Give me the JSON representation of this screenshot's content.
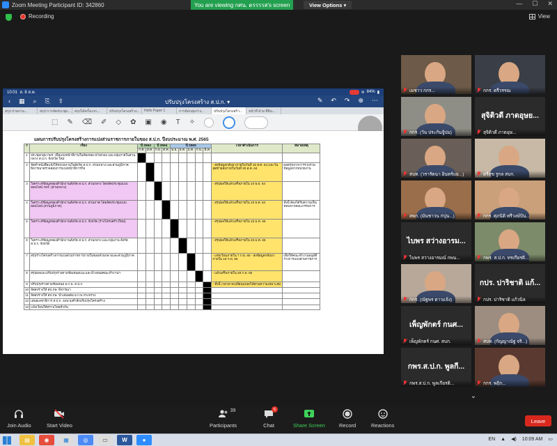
{
  "window": {
    "title": "Zoom Meeting Participant ID: 342860",
    "viewing_banner": "You are viewing กศน. ตรรรรส's screen",
    "view_options": "View Options"
  },
  "status": {
    "recording": "Recording",
    "view": "View"
  },
  "shared_screen": {
    "time": "10:01",
    "date": "ส. 8 ส.ค.",
    "battery": "84%",
    "document_title": "ปรับปรุงโครงสร้าง ส.ป.ก.",
    "tabs": [
      "สรุป ถ่ายงาน...",
      "สรุป การจัดประชุม...",
      "สรุปได้ครั้งแรก...",
      "ปรับปรุงโครงสร้าง...",
      "Hello Paper 1",
      "การจัดกลุ่มร่าง...",
      "ปรับปรุงโครงสร้า...",
      "หน้าที่ ฝ่าย ที่ดิน..."
    ],
    "sheet_title": "แผนการปรับปรุงโครงสร้างการแบ่งส่วนราชการภายในของ ส.ป.ก. ปีงบประมาณ พ.ศ. 2565",
    "table": {
      "header_item": "เรื่อง",
      "header_y64": "ปี 2564",
      "header_y64b": "ปี 2564",
      "header_y65": "ปี 2565",
      "months": [
        "ก.ค.",
        "ส.ค.",
        "ก.ย.",
        "ต.ค.",
        "พ.ย.",
        "ธ.ค.",
        "ม.ค.",
        "ก.พ.",
        "มี.ค."
      ],
      "header_date": "เวลาดำเนินการ",
      "header_note": "หมายเหตุ",
      "rows": [
        {
          "num": "1",
          "activity": "ประชุมกลุ่ม กพร. เพื่อแบ่งหน้าที่งานในห้องของ ฝ่าย/กอง และกลุ่มภายในส่วนกลาง ส.ป.ก. จังหวัด ใหม่",
          "bar": 0,
          "date": "",
          "note": ""
        },
        {
          "num": "2",
          "activity": "จัดทำหนังสือแจ้งให้หน่วยงานในสังกัด ส.ป.ก. ส่วนกลาง และส่วนภูมิภาค พิจารณาตรวจสอบการแบ่งหน้าที่ภารกิจ",
          "bar": 1,
          "date": "- ส่งข้อมูลกลับมาภายในวันที่ 15 ส.ค. 64 และวันสุดท้ายส่งภายในวันที่ 30 ส.ค. 64",
          "note": "ผลสรุปจากการรวบรวมข้อมูลจากหน่วยงาน"
        },
        {
          "num": "3",
          "activity": "วิเคราะห์ข้อมูลของสำนักงานสังกัด ส.ป.ก. ส่วนกลาง โดยจัดประชุมแบบออนไลน์ กพร. (ส่วนกลาง)",
          "bar": 2,
          "date": "- สรุปผลให้แล้วเสร็จภายใน 10 พ.ย. 64",
          "note": ""
        },
        {
          "num": "4",
          "activity": "วิเคราะห์ข้อมูลของสำนักงานสังกัด ส.ป.ก. ส่วนภาค โดยจัดประชุมแบบออนไลน์ (ส่วนภูมิภาค)",
          "bar": 3,
          "date": "- สรุปผลให้แล้วเสร็จภายใน 16 ธ.ค. 64",
          "note": "ทั้งนี้ ต้องได้รับความเห็นชอบจากคณะกรรมการ"
        },
        {
          "num": "5",
          "activity": "วิเคราะห์ข้อมูลของสำนักงานสังกัด ส.ป.ก. จังหวัด (ร่างโครงสร้างใหม่)",
          "bar": 4,
          "date": "- สรุปผลให้แล้วเสร็จภายใน 15 ม.ค. 65",
          "note": ""
        },
        {
          "num": "6",
          "activity": "วิเคราะห์ข้อมูลของสำนักงานสังกัด ส.ป.ก. ส่วนกลาง และกลุ่มงาน สังกัด ส.ป.ก. จังหวัด",
          "bar": 5,
          "date": "- สรุปผลให้แล้วเสร็จภายใน 25 ม.ค. 65",
          "note": ""
        },
        {
          "num": "7",
          "activity": "สรุปร่างโครงสร้างการแบ่งส่วนราชการภายในของส่วนกลางและส่วนภูมิภาค",
          "bar": 6,
          "date": "- แจ้งเวียนภายใน 7 ก.พ. 65 - ส่งข้อมูลกลับมาภายใน 18 ก.พ. 65",
          "note": "เพื่อให้คณะทำงานอนุมัติร่างการแบ่งส่วนราชการ"
        },
        {
          "num": "8",
          "activity": "สรุปผลและปรับปรุงร่างตามข้อเสนอแนะและนำเสนอคณะทำงานฯ",
          "bar": 7,
          "date": "- แล้วเสร็จภายใน 28 ก.พ. 65",
          "note": ""
        },
        {
          "num": "9",
          "activity": "ปรับปรุงร่างตามข้อเสนอ อ.ก.พ. ส.ป.ก.",
          "bar": 8,
          "date": "- ทั้งนี้ เวลาอาจเปลี่ยนแปลงได้ตามความเหมาะสม",
          "note": ""
        },
        {
          "num": "10",
          "activity": "จัดส่งร่างให้ สป.กษ. พิจารณา",
          "bar": 8,
          "date": "",
          "note": ""
        },
        {
          "num": "11",
          "activity": "จัดส่งร่างให้ สป.กษ. นำเสนอต่อ อ.ก.พ.กระทรวง",
          "bar": 8,
          "date": "",
          "note": ""
        },
        {
          "num": "12",
          "activity": "เสนอเลขาธิการ ส.ป.ก. ลงนามคำสั่งปรับปรุงโครงสร้าง",
          "bar": 8,
          "date": "",
          "note": ""
        },
        {
          "num": "13",
          "activity": "แจ้งเวียนให้ทราบโดยทั่วกัน",
          "bar": 8,
          "date": "",
          "note": ""
        }
      ]
    }
  },
  "gallery": {
    "tiles": [
      {
        "name": "เมชาว กกร...",
        "bg": "#6d5a48",
        "big": ""
      },
      {
        "name": "กกร. ตรีวรรณ",
        "bg": "#3a3f47",
        "big": ""
      },
      {
        "name": "กกร. (วัน ประกันจู้ปม)",
        "bg": "#8e8e86",
        "big": "",
        "active": true
      },
      {
        "name": "สุจิติวดี ภาดอุษ...",
        "bg": "#2b2b2b",
        "big": "สุจิติวดี ภาดอุษย..."
      },
      {
        "name": "สบท. (วรารัตนา อินทร์แย...)",
        "bg": "#6a5f58",
        "big": ""
      },
      {
        "name": "ตรีสุข รูกล สบก.",
        "bg": "#c7b9a6",
        "big": ""
      },
      {
        "name": "สพก. (มันชาวน ก่ปุน...)",
        "bg": "#9a6e4a",
        "big": ""
      },
      {
        "name": "กกร. ศุภนิติ ทรีวงษ์ปัน...",
        "bg": "#caa07a",
        "big": ""
      },
      {
        "name": "ไบพร สว่างอารมณ์ กพน...",
        "bg": "#2b2b2b",
        "big": "ไบพร สว่างอารม..."
      },
      {
        "name": "กพร. ส.ป.ก. ทรเกียรติ...",
        "bg": "#7c8b6a",
        "big": ""
      },
      {
        "name": "กกร. (ณัฐพร ดาวแจ้ง)",
        "bg": "#b7a89a",
        "big": ""
      },
      {
        "name": "กปร. ปาริชาติ แก้วนิล",
        "bg": "#2b2b2b",
        "big": "กปร. ปาริชาติ แก้..."
      },
      {
        "name": "เพ็ญพักตร์ กนศ. สบก.",
        "bg": "#2b2b2b",
        "big": "เพ็ญพักตร์ กนศ..."
      },
      {
        "name": "สบท. (กัญญาณัฐ จริ...)",
        "bg": "#9c8d80",
        "big": ""
      },
      {
        "name": "กพร.ส.ป.ก. พูลเกียรติ...",
        "bg": "#2b2b2b",
        "big": "กพร.ส.ป.ก. พูลกี..."
      },
      {
        "name": "กกร. พฤิก...",
        "bg": "#5a3a30",
        "big": ""
      }
    ]
  },
  "controls": {
    "join_audio": "Join Audio",
    "start_video": "Start Video",
    "participants": "Participants",
    "participant_count": "39",
    "chat": "Chat",
    "chat_badge": "6",
    "share_screen": "Share Screen",
    "record": "Record",
    "reactions": "Reactions",
    "leave": "Leave"
  },
  "taskbar": {
    "lang": "EN",
    "time": "10:09 AM"
  }
}
